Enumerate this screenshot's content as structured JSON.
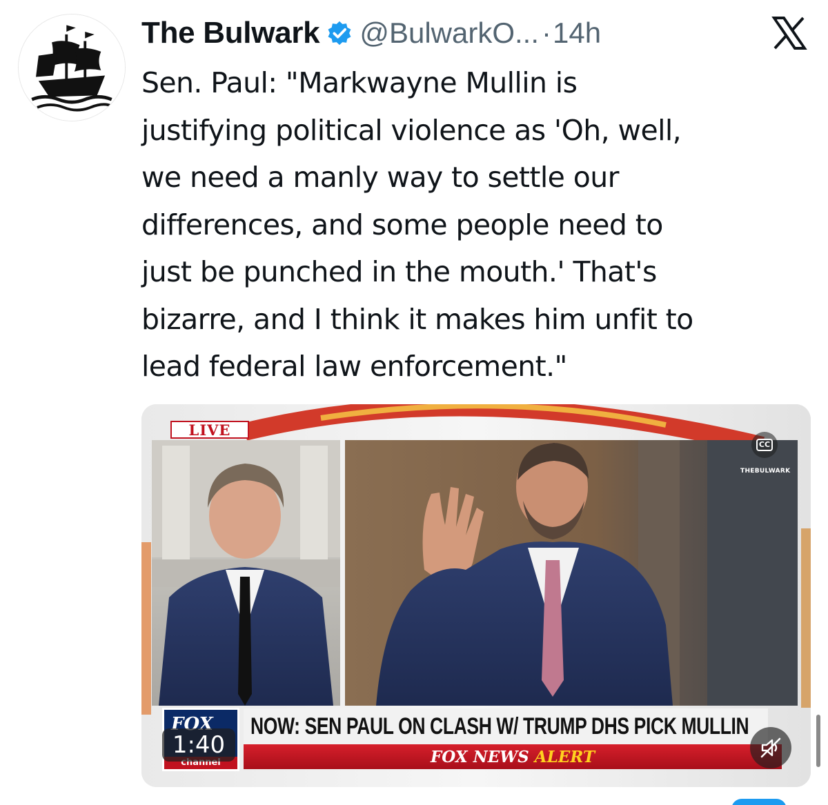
{
  "tweet": {
    "author_name": "The Bulwark",
    "handle": "@BulwarkO...",
    "separator": "·",
    "time": "14h",
    "text_lines": [
      "Sen. Paul: \"Markwayne Mullin is",
      "justifying political violence as 'Oh, well,",
      "we need a manly way to settle our",
      "differences, and some people need to",
      "just be punched in the mouth.' That's",
      "bizarre, and I think it makes him unfit to",
      "lead federal law enforcement.\""
    ],
    "avatar_icon": "pirate-ship-icon",
    "verified_icon": "verified-badge-icon",
    "platform_icon": "x-logo-icon"
  },
  "video": {
    "live_label": "LIVE",
    "cc_label": "CC",
    "watermark": "THEBULWARK",
    "chyron": "NOW: SEN PAUL ON CLASH W/ TRUMP DHS PICK MULLIN",
    "alert_brand": "FOX NEWS",
    "alert_word": "ALERT",
    "network_logo": "FOX",
    "network_sub": "channel",
    "duration": "1:40",
    "mute_icon": "mute-icon"
  },
  "colors": {
    "verified_blue": "#1d9bf0",
    "fox_red": "#c1121f",
    "alert_yellow": "#ffd21f",
    "text_secondary": "#536471"
  }
}
